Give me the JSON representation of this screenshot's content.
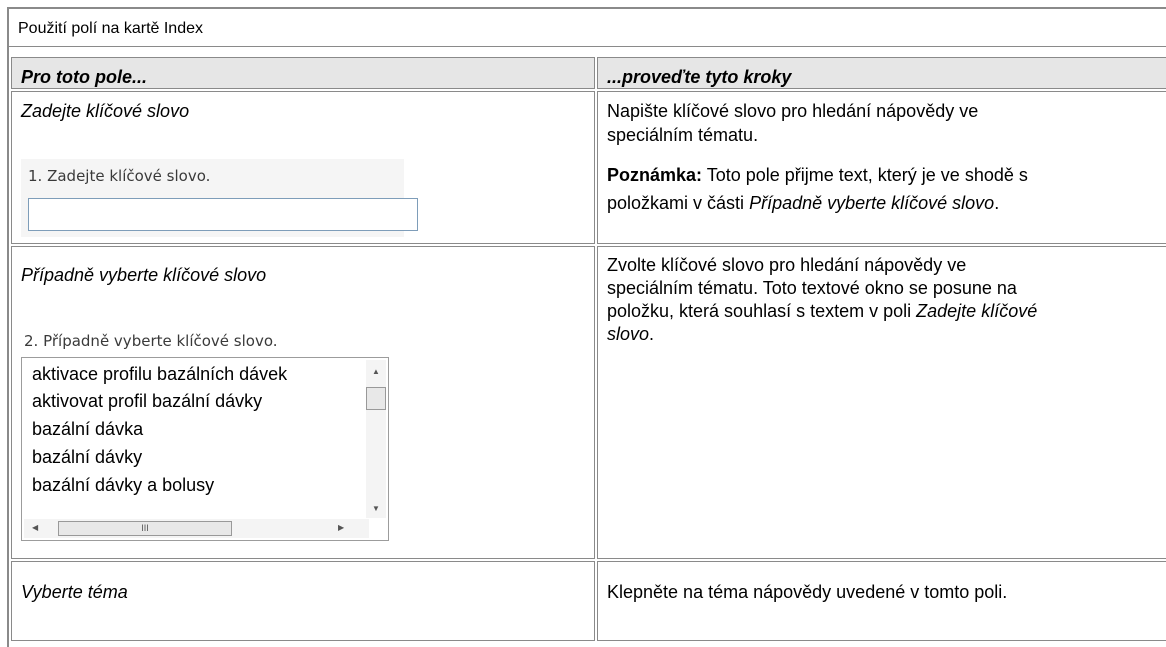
{
  "table": {
    "caption": "Použití polí na kartě Index",
    "header_col1": "Pro toto pole...",
    "header_col2": "...proveďte tyto kroky",
    "rows": [
      {
        "field": "Zadejte klíčové slovo",
        "desc_line1": "Napište klíčové slovo pro hledání nápovědy ve",
        "desc_line2": "speciálním tématu.",
        "note_label": "Poznámka:",
        "note_text1": " Toto pole přijme text, který je ve shodě s",
        "note_text2": "položkami v části ",
        "note_italic": "Případně vyberte klíčové slovo",
        "note_end": "."
      },
      {
        "field": "Případně vyberte klíčové slovo",
        "desc_line1": "Zvolte klíčové slovo pro hledání nápovědy ve",
        "desc_line2": "speciálním tématu. Toto textové okno se posune na",
        "desc_line3a": "položku, která souhlasí s textem v poli ",
        "desc_line3b": "Zadejte klíčové",
        "desc_line4a": "slovo",
        "desc_line4b": "."
      },
      {
        "field": "Vyberte téma",
        "desc_line1": "Klepněte na téma nápovědy uvedené v tomto poli."
      }
    ]
  },
  "keyword_input": {
    "label": "1. Zadejte klíčové slovo.",
    "value": ""
  },
  "keyword_list": {
    "label": "2. Případně vyberte klíčové slovo.",
    "items": [
      "aktivace profilu bazálních dávek",
      "aktivovat profil bazální dávky",
      "bazální dávka",
      "bazální dávky",
      "bazální dávky a bolusy"
    ],
    "scroll_thumb_glyph": "III"
  }
}
